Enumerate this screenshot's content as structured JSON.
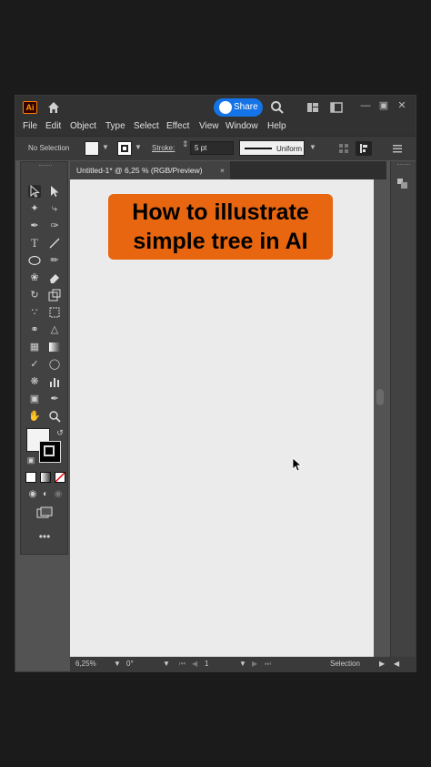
{
  "app": {
    "logo": "Ai",
    "share_label": "Share"
  },
  "menu": [
    "File",
    "Edit",
    "Object",
    "Type",
    "Select",
    "Effect",
    "View",
    "Window",
    "Help"
  ],
  "control_bar": {
    "selection_label": "No Selection",
    "stroke_label": "Stroke:",
    "stroke_value": "5 pt",
    "profile_label": "Uniform"
  },
  "document_tab": {
    "title": "Untitled-1* @ 6,25 % (RGB/Preview)",
    "close": "×"
  },
  "artboard": {
    "banner_line1": "How to illustrate",
    "banner_line2": "simple tree in AI",
    "banner_color": "#e8660f"
  },
  "status_bar": {
    "zoom": "6,25%",
    "rotation": "0°",
    "artboard_number": "1",
    "mode": "Selection"
  },
  "colors": {
    "accent": "#1473e6",
    "app_bg": "#535353"
  }
}
